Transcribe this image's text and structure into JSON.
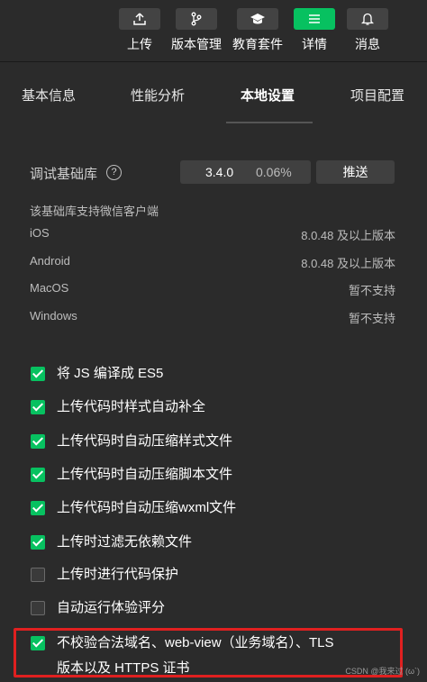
{
  "toolbar": {
    "buttons": [
      {
        "label": "上传",
        "icon": "upload-icon"
      },
      {
        "label": "版本管理",
        "icon": "branch-icon"
      },
      {
        "label": "教育套件",
        "icon": "graduation-cap-icon"
      },
      {
        "label": "详情",
        "icon": "menu-icon",
        "active": true
      },
      {
        "label": "消息",
        "icon": "bell-icon"
      }
    ]
  },
  "tabs": [
    {
      "label": "基本信息"
    },
    {
      "label": "性能分析"
    },
    {
      "label": "本地设置",
      "active": true
    },
    {
      "label": "项目配置"
    }
  ],
  "debug_lib": {
    "label": "调试基础库",
    "help": "?",
    "version": "3.4.0",
    "percent": "0.06%",
    "push_label": "推送"
  },
  "support": {
    "title": "该基础库支持微信客户端",
    "clients": [
      {
        "name": "iOS",
        "version": "8.0.48 及以上版本"
      },
      {
        "name": "Android",
        "version": "8.0.48 及以上版本"
      },
      {
        "name": "MacOS",
        "version": "暂不支持"
      },
      {
        "name": "Windows",
        "version": "暂不支持"
      }
    ]
  },
  "options": [
    {
      "label": "将 JS 编译成 ES5",
      "checked": true
    },
    {
      "label": "上传代码时样式自动补全",
      "checked": true
    },
    {
      "label": "上传代码时自动压缩样式文件",
      "checked": true
    },
    {
      "label": "上传代码时自动压缩脚本文件",
      "checked": true
    },
    {
      "label": "上传代码时自动压缩wxml文件",
      "checked": true
    },
    {
      "label": "上传时过滤无依赖文件",
      "checked": true
    },
    {
      "label": "上传时进行代码保护",
      "checked": false
    },
    {
      "label": "自动运行体验评分",
      "checked": false
    },
    {
      "label": "不校验合法域名、web-view（业务域名）、TLS",
      "label_line2": "版本以及 HTTPS 证书",
      "checked": true
    }
  ],
  "colors": {
    "accent": "#07c160",
    "highlight": "#e02020",
    "background": "#2b2b2b"
  },
  "watermark": "CSDN @我来过 (ω`)"
}
